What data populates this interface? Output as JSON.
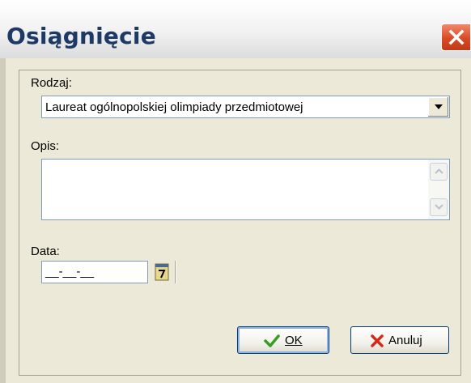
{
  "window": {
    "title": "Osiągnięcie",
    "close_icon": "close-icon"
  },
  "form": {
    "rodzaj_label": "Rodzaj:",
    "rodzaj_value": "Laureat ogólnopolskiej olimpiady przedmiotowej",
    "opis_label": "Opis:",
    "opis_value": "",
    "data_label": "Data:",
    "data_value": "__-__-__"
  },
  "buttons": {
    "ok_label": "OK",
    "ok_icon": "checkmark-icon",
    "cancel_label": "Anuluj",
    "cancel_icon": "x-icon",
    "calendar_icon": "calendar-icon"
  },
  "colors": {
    "title": "#1d3a66",
    "close_button": "#d94a26",
    "dialog_background": "#ece9d8",
    "ok_check": "#3a9d23",
    "cancel_x": "#d42a1a"
  }
}
